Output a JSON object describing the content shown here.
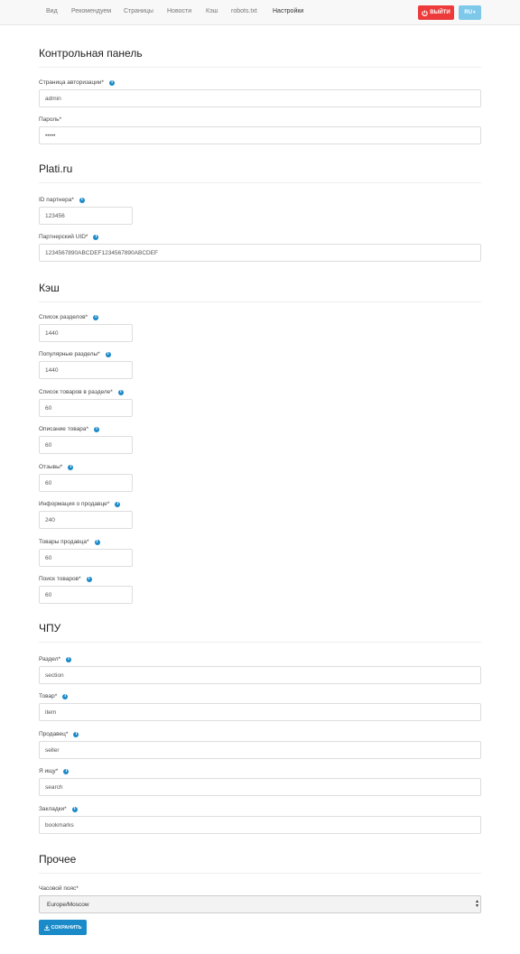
{
  "nav": {
    "items": [
      "Вид",
      "Рекомендуем",
      "Страницы",
      "Новости",
      "Кэш",
      "robots.txt",
      "Настройки"
    ],
    "logout_label": "ВЫЙТИ",
    "lang_label": "RU"
  },
  "sections": {
    "control_panel": {
      "title": "Контрольная панель",
      "login_label": "Страница авторизации*",
      "login_value": "admin",
      "password_label": "Пароль*",
      "password_value": "•••••"
    },
    "plati": {
      "title": "Plati.ru",
      "partner_id_label": "ID партнера*",
      "partner_id_value": "123456",
      "partner_uid_label": "Партнерский UID*",
      "partner_uid_value": "1234567890ABCDEF1234567890ABCDEF"
    },
    "cache": {
      "title": "Кэш",
      "fields": [
        {
          "label": "Список разделов*",
          "value": "1440"
        },
        {
          "label": "Популярные разделы*",
          "value": "1440"
        },
        {
          "label": "Список товаров в разделе*",
          "value": "60"
        },
        {
          "label": "Описание товара*",
          "value": "60"
        },
        {
          "label": "Отзывы*",
          "value": "60"
        },
        {
          "label": "Информация о продавце*",
          "value": "240"
        },
        {
          "label": "Товары продавца*",
          "value": "60"
        },
        {
          "label": "Поиск товаров*",
          "value": "60"
        }
      ]
    },
    "seo": {
      "title": "ЧПУ",
      "fields": [
        {
          "label": "Раздел*",
          "value": "section"
        },
        {
          "label": "Товар*",
          "value": "item"
        },
        {
          "label": "Продавец*",
          "value": "seller"
        },
        {
          "label": "Я ищу*",
          "value": "search"
        },
        {
          "label": "Закладки*",
          "value": "bookmarks"
        }
      ]
    },
    "other": {
      "title": "Прочее",
      "timezone_label": "Часовой пояс*",
      "timezone_value": "Europe/Moscow"
    }
  },
  "save_label": "СОХРАНИТЬ",
  "colors": {
    "logout_button": "#ed3b3b",
    "lang_button": "#7ec8ea",
    "save_button": "#1b8ac9",
    "info_icon": "#1b8ac9"
  }
}
